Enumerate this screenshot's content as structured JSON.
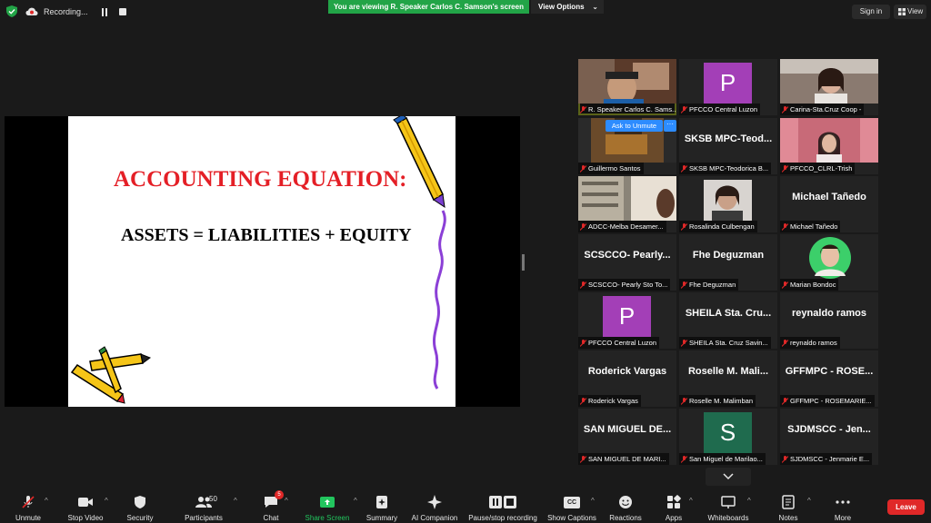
{
  "top": {
    "recording_label": "Recording...",
    "viewing_banner": "You are viewing R. Speaker Carlos C. Samson's screen",
    "view_options": "View Options",
    "sign_in": "Sign in",
    "view": "View",
    "banner_color": "#22a447"
  },
  "slide": {
    "title": "ACCOUNTING EQUATION:",
    "equation": "ASSETS = LIABILITIES + EQUITY",
    "title_color": "#e41f26"
  },
  "gallery": {
    "ask_unmute": "Ask to Unmute",
    "more": "···",
    "tiles": [
      {
        "label": "R. Speaker Carlos C. Sams...",
        "name": ""
      },
      {
        "label": "PFCCO Central Luzon",
        "initial": "P"
      },
      {
        "label": "Carina-Sta.Cruz Coop -"
      },
      {
        "label": "Guillermo Santos"
      },
      {
        "label": "SKSB MPC-Teodorica B...",
        "name": "SKSB MPC-Teod..."
      },
      {
        "label": "PFCCO_CLRL-Trish"
      },
      {
        "label": "ADCC-Melba Desamer..."
      },
      {
        "label": "Rosalinda Culbengan"
      },
      {
        "label": "Michael Tañedo",
        "name": "Michael Tañedo"
      },
      {
        "label": "SCSCCO- Pearly Sto To...",
        "name": "SCSCCO- Pearly..."
      },
      {
        "label": "Fhe Deguzman",
        "name": "Fhe Deguzman"
      },
      {
        "label": "Marian Bondoc"
      },
      {
        "label": "PFCCO Central Luzon",
        "initial": "P"
      },
      {
        "label": "SHEILA Sta. Cruz Savin...",
        "name": "SHEILA Sta. Cru..."
      },
      {
        "label": "reynaldo ramos",
        "name": "reynaldo ramos"
      },
      {
        "label": "Roderick Vargas",
        "name": "Roderick Vargas"
      },
      {
        "label": "Roselle M. Malimban",
        "name": "Roselle M. Mali..."
      },
      {
        "label": "GFFMPC - ROSEMARIE...",
        "name": "GFFMPC - ROSE..."
      },
      {
        "label": "SAN MIGUEL DE MARI...",
        "name": "SAN MIGUEL DE..."
      },
      {
        "label": "San Miguel de Marilao...",
        "initial": "S"
      },
      {
        "label": "SJDMSCC - Jenmarie E...",
        "name": "SJDMSCC - Jen..."
      }
    ]
  },
  "toolbar": {
    "unmute": "Unmute",
    "stop_video": "Stop Video",
    "security": "Security",
    "participants": "Participants",
    "participants_count": "50",
    "chat": "Chat",
    "chat_badge": "5",
    "share_screen": "Share Screen",
    "summary": "Summary",
    "ai_companion": "AI Companion",
    "pause_stop_recording": "Pause/stop recording",
    "show_captions": "Show Captions",
    "captions_icon_text": "CC",
    "reactions": "Reactions",
    "apps": "Apps",
    "whiteboards": "Whiteboards",
    "notes": "Notes",
    "more": "More",
    "leave": "Leave",
    "share_color": "#22c55e",
    "leave_color": "#e02828"
  }
}
